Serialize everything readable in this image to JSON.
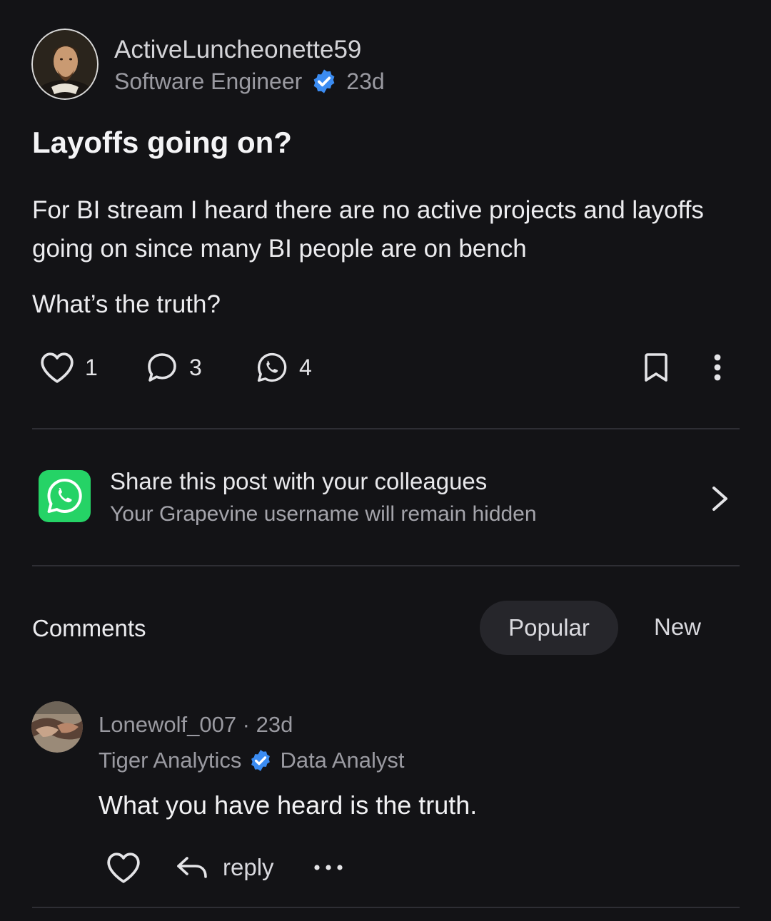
{
  "post": {
    "author": "ActiveLuncheonette59",
    "role": "Software Engineer",
    "age": "23d",
    "title": "Layoffs going on?",
    "body": [
      "For BI stream I heard there are no active projects and layoffs going on since many BI people are on bench",
      "What’s the truth?"
    ],
    "likes": "1",
    "comments": "3",
    "shares": "4"
  },
  "share": {
    "title": "Share this post with your colleagues",
    "subtitle": "Your Grapevine username will remain hidden"
  },
  "comments_section": {
    "label": "Comments",
    "sort_popular": "Popular",
    "sort_new": "New"
  },
  "comment": {
    "author_line": "Lonewolf_007 · 23d",
    "company": "Tiger Analytics",
    "role": "Data Analyst",
    "text": "What you have heard is the truth.",
    "reply_label": "reply"
  },
  "icons": [
    "heart-icon",
    "comment-icon",
    "whatsapp-icon",
    "bookmark-icon",
    "more-vertical-icon",
    "chevron-right-icon",
    "verified-badge-icon",
    "reply-arrow-icon",
    "more-horizontal-icon"
  ],
  "colors": {
    "verified": "#3b8cf2",
    "whatsapp": "#25d366",
    "background": "#131316"
  }
}
